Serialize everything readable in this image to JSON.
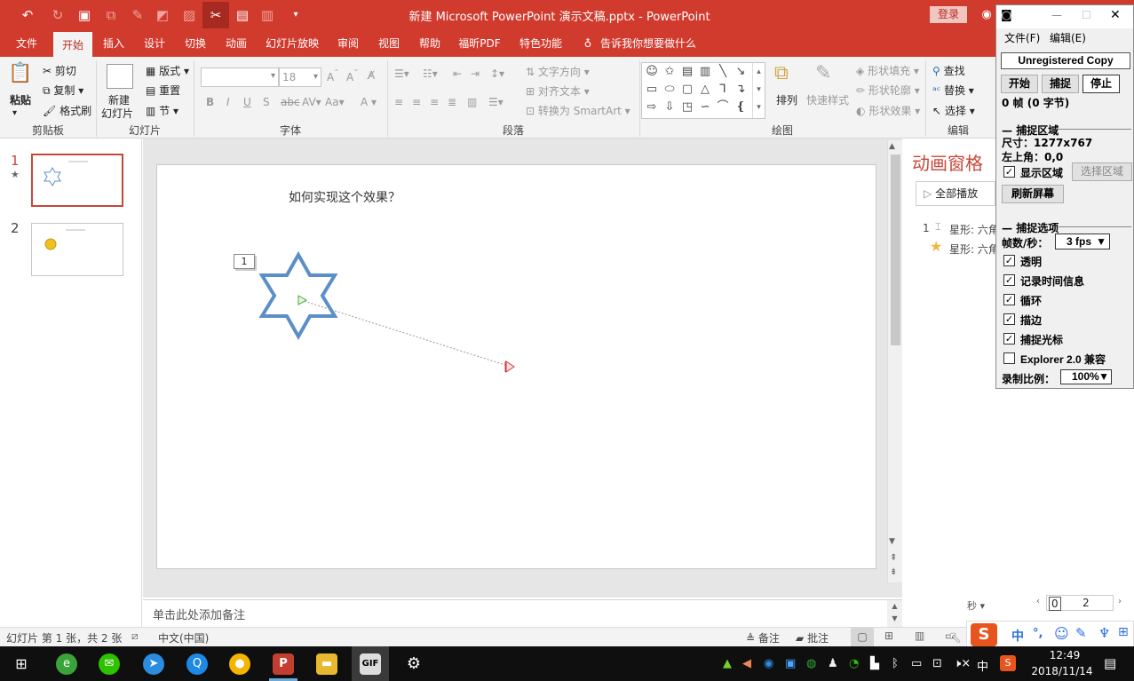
{
  "title_bar": {
    "doc_title": "新建 Microsoft PowerPoint 演示文稿.pptx - PowerPoint",
    "login_label": "登录",
    "quick_access": [
      "undo-icon",
      "redo-icon",
      "present-icon",
      "copy-icon",
      "format-icon",
      "shape-icon",
      "cut-icon",
      "save-icon",
      "layout-icon",
      "more-icon"
    ]
  },
  "tabs": [
    "文件",
    "开始",
    "插入",
    "设计",
    "切换",
    "动画",
    "幻灯片放映",
    "审阅",
    "视图",
    "帮助",
    "福昕PDF",
    "特色功能"
  ],
  "tell_me": "告诉我你想要做什么",
  "ribbon": {
    "clipboard": {
      "paste": "粘贴",
      "cut": "剪切",
      "copy": "复制",
      "format_painter": "格式刷",
      "label": "剪贴板"
    },
    "slides": {
      "new_slide": "新建",
      "new_slide2": "幻灯片",
      "layout": "版式",
      "reset": "重置",
      "section": "节",
      "label": "幻灯片"
    },
    "font": {
      "size": "18",
      "label": "字体"
    },
    "paragraph": {
      "text_direction": "文字方向",
      "align_text": "对齐文本",
      "smartart": "转换为 SmartArt",
      "label": "段落"
    },
    "drawing": {
      "arrange": "排列",
      "quick_styles": "快速样式",
      "fill": "形状填充",
      "outline": "形状轮廓",
      "effects": "形状效果",
      "label": "绘图"
    },
    "editing": {
      "find": "查找",
      "replace": "替换",
      "select": "选择",
      "label": "编辑"
    }
  },
  "slides_panel": {
    "numbers": [
      "1",
      "2"
    ]
  },
  "slide": {
    "text": "如何实现这个效果？",
    "anim_tag": "1",
    "star_color": "#5b8fc8"
  },
  "notes_placeholder": "单击此处添加备注",
  "anim_pane": {
    "title": "动画窗格",
    "play_all": "全部播放",
    "item_index": "1",
    "item1": "星形: 六角",
    "item2": "星形: 六角",
    "seconds": "秒",
    "timeline": [
      "0",
      "2"
    ]
  },
  "status": {
    "slide_info": "幻灯片 第 1 张，共 2 张",
    "language": "中文(中国)",
    "notes": "备注",
    "comments": "批注"
  },
  "capture": {
    "menu_file": "文件(F)",
    "menu_edit": "编辑(E)",
    "unregistered": "Unregistered Copy",
    "btn_start": "开始",
    "btn_capture": "捕捉",
    "btn_stop": "停止",
    "frames": "0 帧 (0 字节)",
    "section_region": "捕捉区域",
    "size": "尺寸：1277x767",
    "top_left": "左上角：0,0",
    "show_region": "显示区域",
    "select_region": "选择区域",
    "refresh": "刷新屏幕",
    "section_options": "捕捉选项",
    "fps_label": "帧数/秒：",
    "fps_value": "3 fps",
    "opt_transparent": "透明",
    "opt_time": "记录时间信息",
    "opt_loop": "循环",
    "opt_border": "描边",
    "opt_cursor": "捕捉光标",
    "opt_explorer": "Explorer 2.0 兼容",
    "scale_label": "录制比例：",
    "scale_value": "100%"
  },
  "taskbar": {
    "time": "12:49",
    "date": "2018/11/14",
    "ime": "中"
  },
  "ime_bar": {
    "lang": "中",
    "punct": "°,"
  }
}
